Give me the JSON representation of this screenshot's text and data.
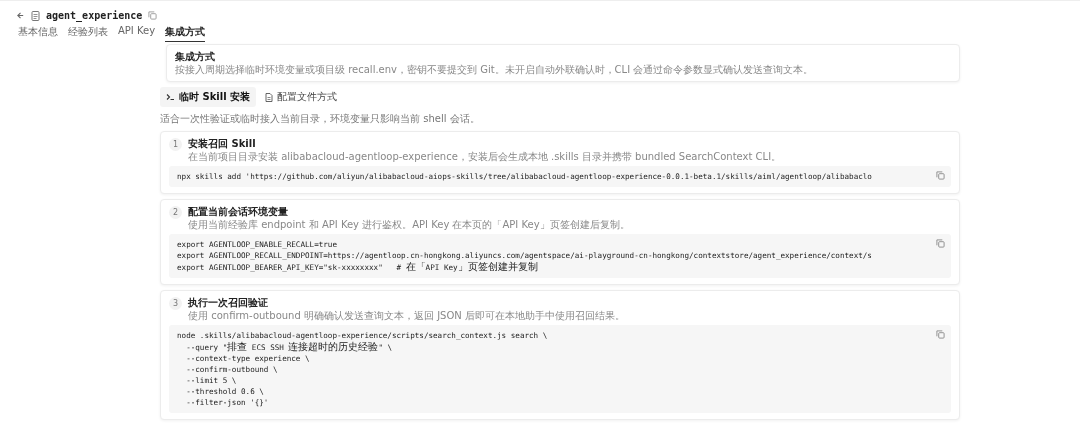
{
  "header": {
    "title": "agent_experience"
  },
  "tabs": [
    {
      "label": "基本信息",
      "selected": false
    },
    {
      "label": "经验列表",
      "selected": false
    },
    {
      "label": "API Key",
      "selected": false
    },
    {
      "label": "集成方式",
      "selected": true
    }
  ],
  "intro_card": {
    "title": "集成方式",
    "description": "按接入周期选择临时环境变量或项目级 recall.env，密钥不要提交到 Git。未开启自动外联确认时，CLI 会通过命令参数显式确认发送查询文本。"
  },
  "modes": [
    {
      "label": "临时 Skill 安装",
      "kind": "terminal",
      "selected": true
    },
    {
      "label": "配置文件方式",
      "kind": "file",
      "selected": false
    }
  ],
  "mode_note": "适合一次性验证或临时接入当前目录，环境变量只影响当前 shell 会话。",
  "steps": [
    {
      "number": "1",
      "title": "安装召回 Skill",
      "description": "在当前项目目录安装 alibabacloud-agentloop-experience，安装后会生成本地 .skills 目录并携带 bundled SearchContext CLI。",
      "code": [
        "npx skills add 'https://github.com/aliyun/alibabacloud-aiops-skills/tree/alibabacloud-agentloop-experience-0.0.1-beta.1/skills/aiml/agentloop/alibabaclo"
      ]
    },
    {
      "number": "2",
      "title": "配置当前会话环境变量",
      "description": "使用当前经验库 endpoint 和 API Key 进行鉴权。API Key 在本页的「API Key」页签创建后复制。",
      "code": [
        "export AGENTLOOP_ENABLE_RECALL=true",
        "export AGENTLOOP_RECALL_ENDPOINT=https://agentloop.cn-hongkong.aliyuncs.com/agentspace/ai-playground-cn-hongkong/contextstore/agent_experience/context/s",
        "export AGENTLOOP_BEARER_API_KEY=\"sk-xxxxxxxx\"   # 在「API Key」页签创建并复制"
      ]
    },
    {
      "number": "3",
      "title": "执行一次召回验证",
      "description": "使用 confirm-outbound 明确确认发送查询文本，返回 JSON 后即可在本地助手中使用召回结果。",
      "code": [
        "node .skills/alibabacloud-agentloop-experience/scripts/search_context.js search \\",
        "  --query \"排查 ECS SSH 连接超时的历史经验\" \\",
        "  --context-type experience \\",
        "  --confirm-outbound \\",
        "  --limit 5 \\",
        "  --threshold 0.6 \\",
        "  --filter-json '{}'"
      ]
    }
  ]
}
